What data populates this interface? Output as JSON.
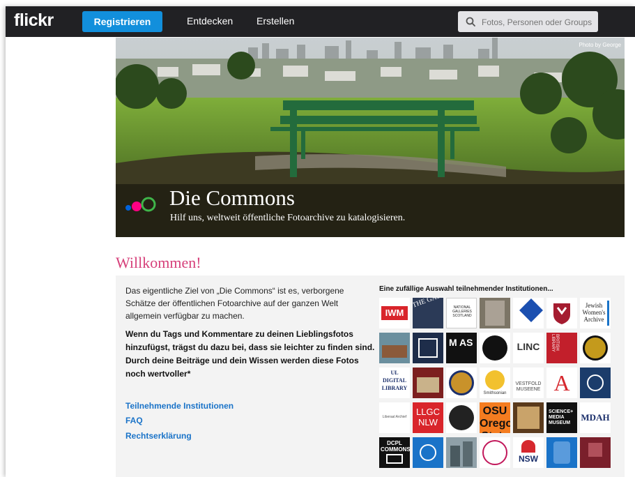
{
  "nav": {
    "logo": "flickr",
    "register": "Registrieren",
    "explore": "Entdecken",
    "create": "Erstellen",
    "search_placeholder": "Fotos, Personen oder Groups"
  },
  "hero": {
    "credit": "Photo by George",
    "title": "Die Commons",
    "subtitle": "Hilf uns, weltweit öffentliche Fotoarchive zu katalogisieren."
  },
  "welcome": {
    "heading": "Willkommen!",
    "intro": "Das eigentliche Ziel von „Die Commons“ ist es, verborgene Schätze der öffentlichen Fotoarchive auf der ganzen Welt allgemein verfügbar zu machen.",
    "bold": "Wenn du Tags und Kommentare zu deinen Lieblingsfotos hinzufügst, trägst du dazu bei, dass sie leichter zu finden sind. Durch deine Beiträge und dein Wissen werden diese Fotos noch wertvoller*",
    "links": [
      "Teilnehmende Institutionen",
      "FAQ",
      "Rechtserklärung"
    ]
  },
  "institutions": {
    "heading": "Eine zufällige Auswahl teilnehmender Institutionen...",
    "tiles": [
      {
        "label": "IWM"
      },
      {
        "label": "THE GAL"
      },
      {
        "label": "NATIONAL GALLERIES SCOTLAND"
      },
      {
        "label": ""
      },
      {
        "label": ""
      },
      {
        "label": ""
      },
      {
        "label": "Jewish Women's Archive"
      },
      {
        "label": ""
      },
      {
        "label": ""
      },
      {
        "label": "M AS"
      },
      {
        "label": ""
      },
      {
        "label": "LINC"
      },
      {
        "label": "BRITISH LIBRARY"
      },
      {
        "label": ""
      },
      {
        "label": "UL DIGITAL LIBRARY"
      },
      {
        "label": ""
      },
      {
        "label": ""
      },
      {
        "label": "Smithsonian"
      },
      {
        "label": "VESTFOLD MUSEENE"
      },
      {
        "label": "A"
      },
      {
        "label": ""
      },
      {
        "label": "Liberaal Archief"
      },
      {
        "label": "LLGC NLW"
      },
      {
        "label": ""
      },
      {
        "label": "OSU Oregon State"
      },
      {
        "label": ""
      },
      {
        "label": "SCIENCE+ MEDIA MUSEUM"
      },
      {
        "label": "MDAH"
      },
      {
        "label": "DCPL COMMONS"
      },
      {
        "label": ""
      },
      {
        "label": ""
      },
      {
        "label": ""
      },
      {
        "label": "NSW"
      },
      {
        "label": ""
      },
      {
        "label": ""
      }
    ]
  },
  "colors": {
    "accent_blue": "#128fdc",
    "brand_pink": "#ff0084",
    "brand_blue": "#0063dc",
    "heading_pink": "#d6407a",
    "link_blue": "#1a73c8"
  }
}
